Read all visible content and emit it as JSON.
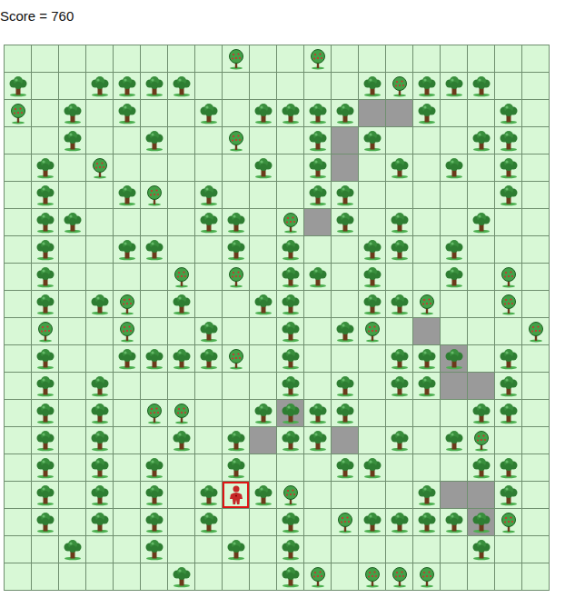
{
  "score_text": "Score = 760",
  "grid": {
    "rows": [
      "........A..A........",
      "T..TTTT......TATTT..",
      "A.T.T..T.TTTT##T..T.",
      "..T..T..A..T#T...TT.",
      ".T.A.....T.T#.T.T.T.",
      ".T..TA.T...TT.....T.",
      ".TT....TT.A#T.T..T..",
      ".T..TT..T.T..TT.T...",
      ".T....A.A.TT.T..T.A.",
      ".T.TA.T..TT..TTA..A.",
      ".A..A..T..T.TA.#...A",
      ".T..TTTTA.T...TT%.T.",
      ".T.T......T.T.TT##T.",
      ".T.T.AA..T%TT....TT.",
      ".T.T..T.T#TT#.T.TA..",
      ".T.T.T..T...TT...TT.",
      ".T.T.T.TPTA....T##T.",
      ".T.T.T.T..T.ATTTT%A.",
      "..T..T..T.T......T..",
      "......T...TA.AAA...."
    ]
  }
}
